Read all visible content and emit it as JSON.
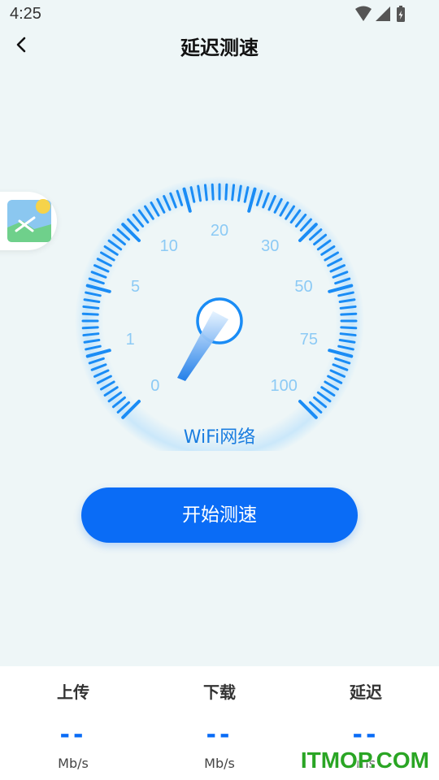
{
  "status": {
    "time": "4:25"
  },
  "header": {
    "title": "延迟测速"
  },
  "gauge": {
    "labels": [
      "0",
      "1",
      "5",
      "10",
      "20",
      "30",
      "50",
      "75",
      "100"
    ],
    "network_label": "WiFi网络",
    "needle_value": "0",
    "accent_color": "#1a8cf5"
  },
  "start_button": {
    "label": "开始测速"
  },
  "stats": [
    {
      "title": "上传",
      "value": "--",
      "unit": "Mb/s"
    },
    {
      "title": "下载",
      "value": "--",
      "unit": "Mb/s"
    },
    {
      "title": "延迟",
      "value": "--",
      "unit": "ms"
    }
  ],
  "watermark": "ITMOP.COM",
  "icons": {
    "back": "chevron-left-icon",
    "wifi": "wifi-icon",
    "signal": "signal-icon",
    "battery": "battery-icon",
    "thumb": "image-icon"
  }
}
